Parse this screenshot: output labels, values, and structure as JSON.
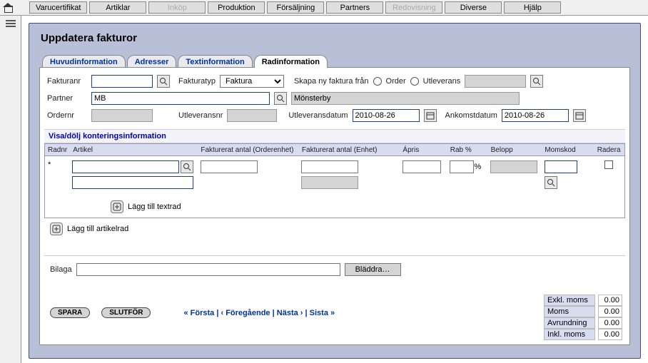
{
  "topmenu": {
    "items": [
      {
        "label": "Varucertifikat"
      },
      {
        "label": "Artiklar"
      },
      {
        "label": "Inköp",
        "disabled": true
      },
      {
        "label": "Produktion"
      },
      {
        "label": "Försäljning"
      },
      {
        "label": "Partners"
      },
      {
        "label": "Redovisning",
        "disabled": true
      },
      {
        "label": "Diverse"
      },
      {
        "label": "Hjälp"
      }
    ]
  },
  "page": {
    "title": "Uppdatera fakturor"
  },
  "tabs": [
    {
      "label": "Huvudinformation"
    },
    {
      "label": "Adresser"
    },
    {
      "label": "Textinformation"
    },
    {
      "label": "Radinformation",
      "active": true
    }
  ],
  "form": {
    "fakturanr_label": "Fakturanr",
    "fakturanr_value": "",
    "fakturatyp_label": "Fakturatyp",
    "fakturatyp_value": "Faktura",
    "skapa_label": "Skapa ny faktura från",
    "order_label": "Order",
    "utleverans_label": "Utleverans",
    "partner_label": "Partner",
    "partner_code": "MB",
    "partner_name": "Mönsterby",
    "ordernr_label": "Ordernr",
    "ordernr_value": "",
    "utleveransnr_label": "Utleveransnr",
    "utleveransnr_value": "",
    "utleveransdatum_label": "Utleveransdatum",
    "utleveransdatum_value": "2010-08-26",
    "ankomstdatum_label": "Ankomstdatum",
    "ankomstdatum_value": "2010-08-26"
  },
  "grid": {
    "toggle_label": "Visa/dölj konteringsinformation",
    "headers": {
      "radnr": "Radnr",
      "artikel": "Artikel",
      "fa_order": "Fakturerat antal (Orderenhet)",
      "fa_enhet": "Fakturerat antal (Enhet)",
      "apris": "Ápris",
      "rab": "Rab %",
      "belopp": "Belopp",
      "momskod": "Momskod",
      "radera": "Radera"
    },
    "row1_radnr": "*",
    "percent_sign": "%",
    "add_textrad": "Lägg till textrad",
    "add_artikelrad": "Lägg till artikelrad"
  },
  "attachment": {
    "label": "Bilaga",
    "browse": "Bläddra…"
  },
  "actions": {
    "save": "SPARA",
    "finish": "SLUTFÖR",
    "first": "« Första",
    "prev": "‹ Föregående",
    "next": "Nästa ›",
    "last": "Sista »",
    "sep": " | "
  },
  "totals": {
    "exkl_label": "Exkl. moms",
    "exkl_val": "0.00",
    "moms_label": "Moms",
    "moms_val": "0.00",
    "avr_label": "Avrundning",
    "avr_val": "0.00",
    "inkl_label": "Inkl. moms",
    "inkl_val": "0.00"
  }
}
